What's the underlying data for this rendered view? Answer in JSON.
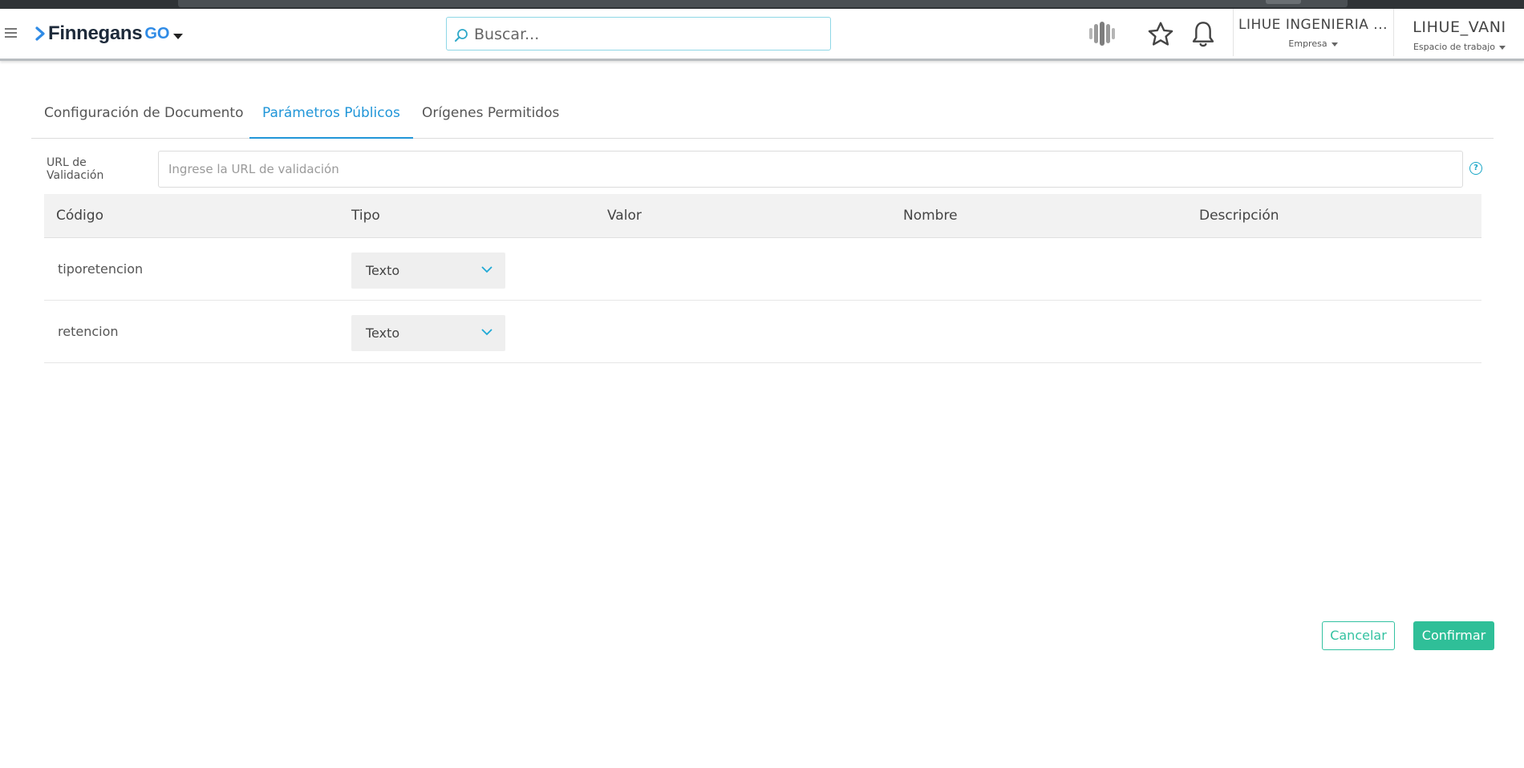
{
  "header": {
    "logo_text": "Finnegans",
    "logo_suffix": "GO",
    "search_placeholder": "Buscar...",
    "company": {
      "name": "LIHUE INGENIERIA ...",
      "label": "Empresa"
    },
    "workspace": {
      "name": "LIHUE_VANI",
      "label": "Espacio de trabajo"
    }
  },
  "tabs": [
    {
      "label": "Configuración de Documento",
      "active": false
    },
    {
      "label": "Parámetros Públicos",
      "active": true
    },
    {
      "label": "Orígenes Permitidos",
      "active": false
    }
  ],
  "url_field": {
    "label": "URL de Validación",
    "placeholder": "Ingrese la URL de validación",
    "value": ""
  },
  "table": {
    "columns": [
      "Código",
      "Tipo",
      "Valor",
      "Nombre",
      "Descripción"
    ],
    "rows": [
      {
        "codigo": "tiporetencion",
        "tipo": "Texto",
        "valor": "",
        "nombre": "",
        "descripcion": ""
      },
      {
        "codigo": "retencion",
        "tipo": "Texto",
        "valor": "",
        "nombre": "",
        "descripcion": ""
      }
    ]
  },
  "actions": {
    "cancel_label": "Cancelar",
    "confirm_label": "Confirmar"
  },
  "colors": {
    "accent": "#2196d8",
    "teal": "#2fbf98",
    "search_border": "#8ed7e6"
  }
}
